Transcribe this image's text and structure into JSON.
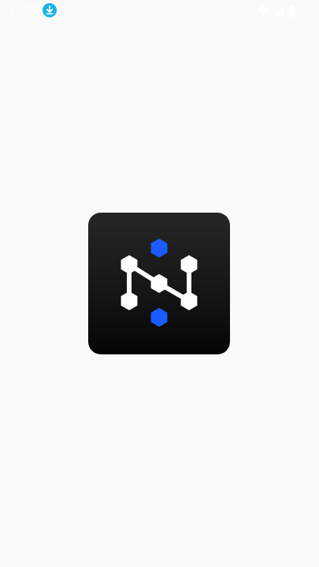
{
  "status_bar": {
    "time": "11:38",
    "notification_icon": "download-icon",
    "icons": [
      "wifi-icon",
      "signal-icon",
      "battery-icon"
    ],
    "notification_color": "#1ab3e6"
  },
  "splash": {
    "logo_icon": "network-hexagon-logo-icon",
    "accent_color": "#1a5cff",
    "background_color": "#fafafa"
  }
}
